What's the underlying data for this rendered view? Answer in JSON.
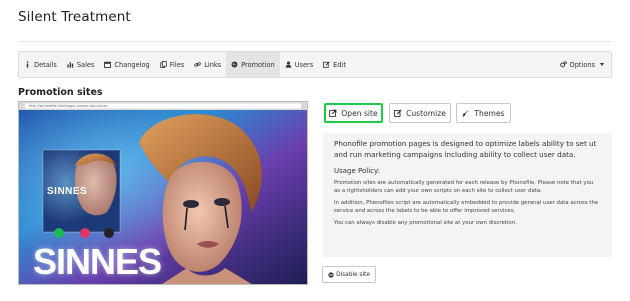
{
  "page": {
    "title": "Silent Treatment"
  },
  "nav": {
    "items": [
      {
        "label": "Details",
        "icon": "info-icon"
      },
      {
        "label": "Sales",
        "icon": "bar-chart-icon"
      },
      {
        "label": "Changelog",
        "icon": "calendar-icon"
      },
      {
        "label": "Files",
        "icon": "files-icon"
      },
      {
        "label": "Links",
        "icon": "link-icon"
      },
      {
        "label": "Promotion",
        "icon": "globe-icon",
        "active": true
      },
      {
        "label": "Users",
        "icon": "user-icon"
      },
      {
        "label": "Edit",
        "icon": "edit-icon"
      }
    ],
    "options_label": "Options"
  },
  "section": {
    "title": "Promotion sites"
  },
  "preview": {
    "url_text": "http://phonofile.link/begin-simple-and-more",
    "album_title": "SINNES",
    "big_title": "SINNES"
  },
  "actions": {
    "open_site": "Open site",
    "customize": "Customize",
    "themes": "Themes",
    "highlight_color": "#1fcc47"
  },
  "info": {
    "lead": "Phonofile promotion pages is designed to optimize labels ability to set ut and run marketing campaigns including ability to collect user data.",
    "policy_title": "Usage Policy:",
    "p1": "Promotion sites are automatically generated for each release by Phonofile. Please note that you as a rightsholders can add your own scripts on each site to collect user data.",
    "p2": "In addition, Phonofiles script are automatically embedded to provide general user data across the service and across the labels to be able to offer improved services.",
    "p3": "You can always disable any promotional site at your own discretion."
  },
  "disable": {
    "label": "Disable site"
  }
}
